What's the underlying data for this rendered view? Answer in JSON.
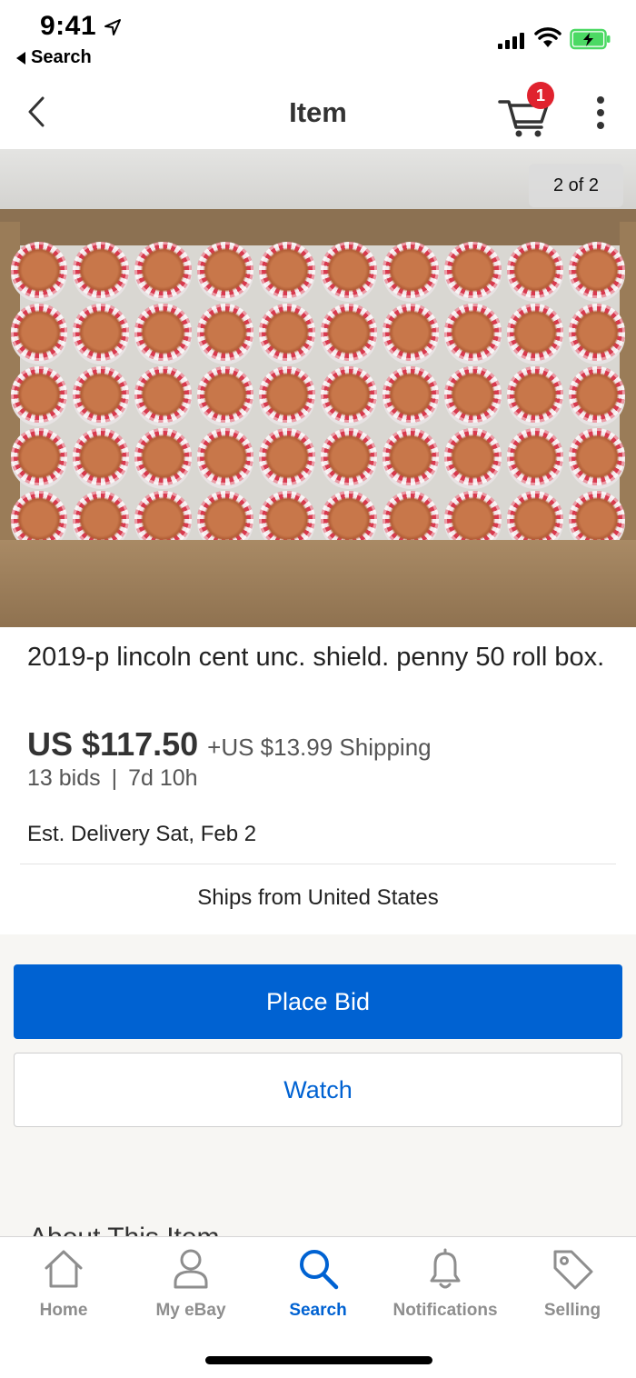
{
  "status_bar": {
    "time": "9:41",
    "back_app": "Search"
  },
  "nav": {
    "title": "Item",
    "cart_count": "1"
  },
  "gallery": {
    "counter": "2 of 2"
  },
  "item": {
    "title": "2019-p lincoln cent unc. shield. penny 50 roll box.",
    "price": "US $117.50",
    "shipping": "+US $13.99 Shipping",
    "bids": "13 bids",
    "separator": "|",
    "time_left": "7d 10h",
    "delivery": "Est. Delivery Sat, Feb 2",
    "ships_from": "Ships from United States"
  },
  "actions": {
    "place_bid": "Place Bid",
    "watch": "Watch"
  },
  "section": {
    "about": "About This Item"
  },
  "tabs": [
    {
      "label": "Home",
      "icon": "home-icon"
    },
    {
      "label": "My eBay",
      "icon": "person-icon"
    },
    {
      "label": "Search",
      "icon": "search-icon",
      "active": true
    },
    {
      "label": "Notifications",
      "icon": "bell-icon"
    },
    {
      "label": "Selling",
      "icon": "tag-icon"
    }
  ],
  "colors": {
    "accent": "#0062d2",
    "badge": "#e0222e",
    "tab_inactive": "#8e8e8e"
  }
}
